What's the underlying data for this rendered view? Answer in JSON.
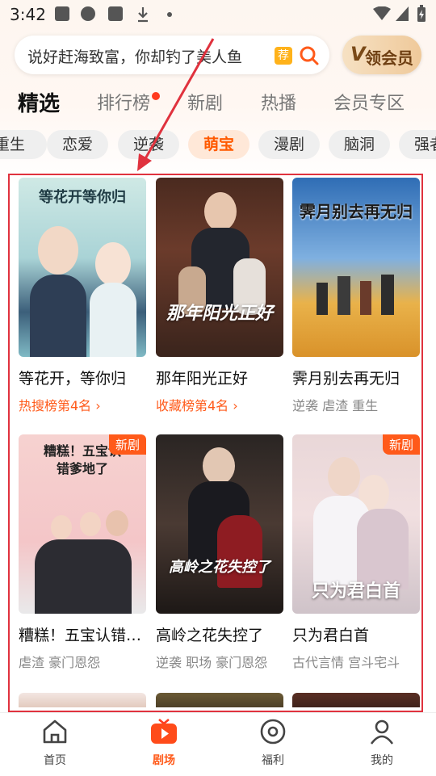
{
  "status_bar": {
    "time": "3:42"
  },
  "search": {
    "placeholder": "说好赶海致富，你却钓了美人鱼",
    "tag": "荐"
  },
  "vip_button": {
    "label": "领会员"
  },
  "tabs": [
    {
      "label": "精选"
    },
    {
      "label": "排行榜"
    },
    {
      "label": "新剧"
    },
    {
      "label": "热播"
    },
    {
      "label": "会员专区"
    }
  ],
  "chips": [
    {
      "label": "重生"
    },
    {
      "label": "恋爱"
    },
    {
      "label": "逆袭"
    },
    {
      "label": "萌宝"
    },
    {
      "label": "漫剧"
    },
    {
      "label": "脑洞"
    },
    {
      "label": "强者"
    }
  ],
  "cards": [
    {
      "title": "等花开，等你归",
      "sub": "热搜榜第4名 ›",
      "poster_text": "等花开等你归"
    },
    {
      "title": "那年阳光正好",
      "sub": "收藏榜第4名 ›",
      "poster_text": "那年阳光正好"
    },
    {
      "title": "霁月别去再无归",
      "sub": "逆袭 虐渣 重生",
      "poster_text": "霁月别去再无归"
    },
    {
      "title": "糟糕！五宝认错…",
      "sub": "虐渣 豪门恩怨",
      "poster_text": "糟糕！五宝认错爹地了",
      "badge": "新剧"
    },
    {
      "title": "高岭之花失控了",
      "sub": "逆袭 职场 豪门恩怨",
      "poster_text": "高岭之花失控了"
    },
    {
      "title": "只为君白首",
      "sub": "古代言情 宫斗宅斗",
      "poster_text": "只为君白首",
      "badge": "新剧"
    }
  ],
  "bottom_nav": [
    {
      "label": "首页"
    },
    {
      "label": "剧场"
    },
    {
      "label": "福利"
    },
    {
      "label": "我的"
    }
  ],
  "colors": {
    "accent": "#ff5a1a",
    "annotation_red": "#e0323e"
  }
}
